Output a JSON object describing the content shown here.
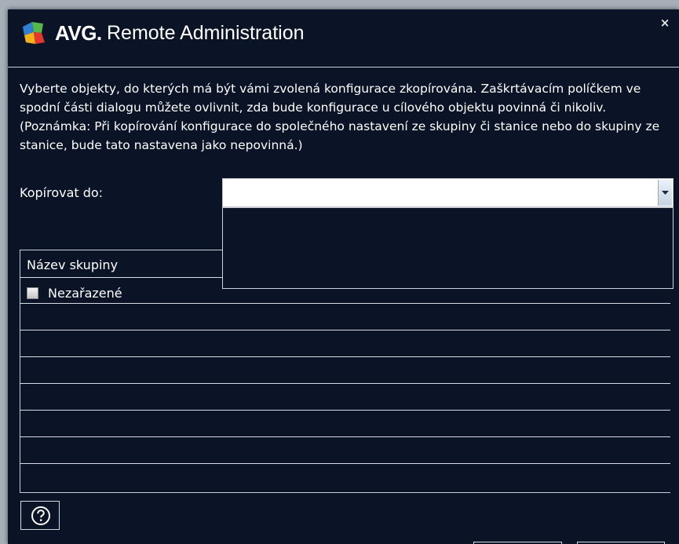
{
  "window": {
    "brand": "AVG.",
    "title": "Remote Administration",
    "close_glyph": "×"
  },
  "dialog": {
    "description": "Vyberte objekty, do kterých má být vámi zvolená konfigurace zkopírována. Zaškrtávacím políčkem ve spodní části dialogu můžete ovlivnit, zda bude konfigurace u cílového objektu povinná či nikoliv. (Poznámka: Při kopírování konfigurace do společného nastavení ze skupiny či stanice nebo do skupiny ze stanice, bude tato nastavena jako nepovinná.)",
    "copy_to_label": "Kopírovat do:",
    "copy_to_value": ""
  },
  "grid": {
    "column_header": "Název skupiny",
    "rows": [
      {
        "label": "Nezařazené",
        "checked": false
      }
    ]
  },
  "icons": {
    "help": "help-icon",
    "close": "close-icon",
    "dropdown": "chevron-down-icon",
    "logo": "avg-logo"
  },
  "colors": {
    "background": "#0a1426",
    "text": "#ffffff",
    "border": "#c9ced6"
  }
}
